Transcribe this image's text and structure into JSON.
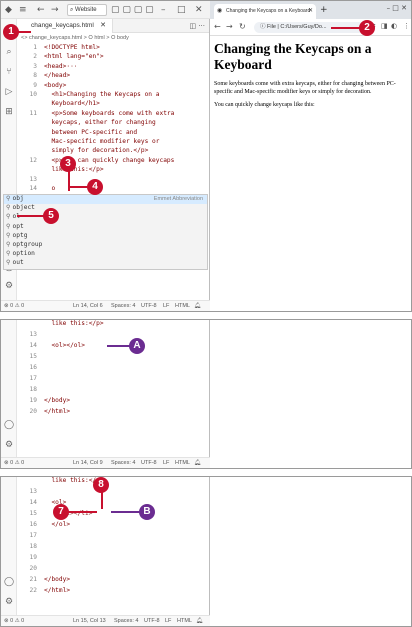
{
  "panel1": {
    "titlebar": {
      "search": "Website"
    },
    "tab_label": "change_keycaps.html",
    "breadcrumb": "<> change_keycaps.html > ⭘ html > ⭘ body",
    "code_lines": [
      {
        "n": "1",
        "t": "<!DOCTYPE html>"
      },
      {
        "n": "2",
        "t": "<html lang=\"en\">"
      },
      {
        "n": "3",
        "t": "<head>···"
      },
      {
        "n": "8",
        "t": "</head>"
      },
      {
        "n": "9",
        "t": "<body>"
      },
      {
        "n": "10",
        "t": "  <h1>Changing the Keycaps on a"
      },
      {
        "n": "",
        "t": "  Keyboard</h1>"
      },
      {
        "n": "11",
        "t": "  <p>Some keyboards come with extra"
      },
      {
        "n": "",
        "t": "  keycaps, either for changing"
      },
      {
        "n": "",
        "t": "  between PC-specific and"
      },
      {
        "n": "",
        "t": "  Mac-specific modifier keys or"
      },
      {
        "n": "",
        "t": "  simply for decoration.</p>"
      },
      {
        "n": "12",
        "t": "  <p>You can quickly change keycaps"
      },
      {
        "n": "",
        "t": "  like this:</p>"
      },
      {
        "n": "13",
        "t": ""
      },
      {
        "n": "14",
        "t": "  o"
      }
    ],
    "suggestions": [
      {
        "label": "obj",
        "detail": "Emmet Abbreviation"
      },
      {
        "label": "object",
        "detail": ""
      },
      {
        "label": "ol",
        "detail": ""
      },
      {
        "label": "opt",
        "detail": ""
      },
      {
        "label": "optg",
        "detail": ""
      },
      {
        "label": "optgroup",
        "detail": ""
      },
      {
        "label": "option",
        "detail": ""
      },
      {
        "label": "out",
        "detail": ""
      }
    ],
    "status": {
      "problems": "⊗ 0 ⚠ 0",
      "position": "Ln 14, Col 6",
      "spaces": "Spaces: 4",
      "encoding": "UTF-8",
      "eol": "LF",
      "lang": "HTML"
    },
    "browser": {
      "tab_title": "Changing the Keycaps on a Keyboard",
      "url": "File  |  C:/Users/Guy/Do...",
      "heading": "Changing the Keycaps on a Keyboard",
      "para1": "Some keyboards come with extra keycaps, either for changing between PC-specific and Mac-specific modifier keys or simply for decoration.",
      "para2": "You can quickly change keycaps like this:"
    }
  },
  "panel2": {
    "code_lines": [
      {
        "n": "",
        "t": "  like this:</p>"
      },
      {
        "n": "13",
        "t": ""
      },
      {
        "n": "14",
        "t": "  <ol></ol>"
      },
      {
        "n": "15",
        "t": ""
      },
      {
        "n": "16",
        "t": ""
      },
      {
        "n": "17",
        "t": ""
      },
      {
        "n": "18",
        "t": ""
      },
      {
        "n": "19",
        "t": "</body>"
      },
      {
        "n": "20",
        "t": "</html>"
      }
    ],
    "status": {
      "problems": "⊗ 0 ⚠ 0",
      "position": "Ln 14, Col 9",
      "spaces": "Spaces: 4",
      "encoding": "UTF-8",
      "eol": "LF",
      "lang": "HTML"
    }
  },
  "panel3": {
    "code_lines": [
      {
        "n": "",
        "t": "  like this:</p>"
      },
      {
        "n": "13",
        "t": ""
      },
      {
        "n": "14",
        "t": "  <ol>"
      },
      {
        "n": "15",
        "t": "    <li></li>"
      },
      {
        "n": "16",
        "t": "  </ol>"
      },
      {
        "n": "17",
        "t": ""
      },
      {
        "n": "18",
        "t": ""
      },
      {
        "n": "19",
        "t": ""
      },
      {
        "n": "20",
        "t": ""
      },
      {
        "n": "21",
        "t": "</body>"
      },
      {
        "n": "22",
        "t": "</html>"
      }
    ],
    "status": {
      "problems": "⊗ 0 ⚠ 0",
      "position": "Ln 15, Col 13",
      "spaces": "Spaces: 4",
      "encoding": "UTF-8",
      "eol": "LF",
      "lang": "HTML"
    }
  },
  "callouts": {
    "c1": "1",
    "c2": "2",
    "c3": "3",
    "c4": "4",
    "c5": "5",
    "c7": "7",
    "c8": "8",
    "cA": "A",
    "cB": "B"
  },
  "colors": {
    "callout_red": "#c8102e",
    "callout_purple": "#6b2c91",
    "tag": "#800000",
    "attr": "#e50000",
    "value": "#0000ff"
  }
}
